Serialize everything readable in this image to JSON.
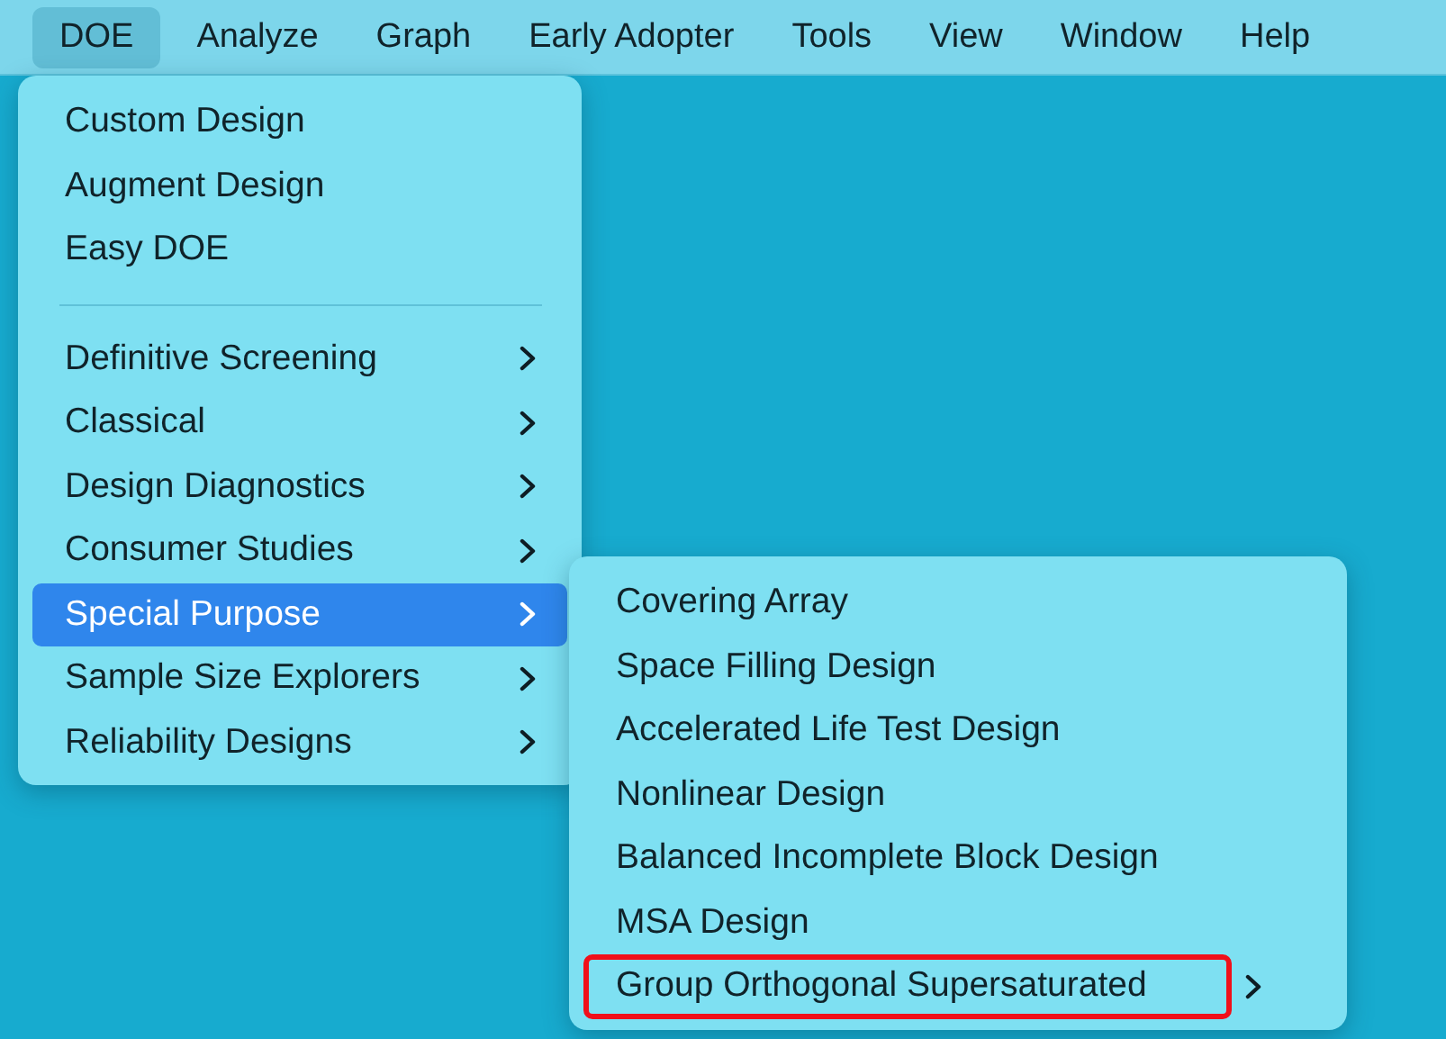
{
  "menu_bar": [
    {
      "label": "DOE",
      "selected": true
    },
    {
      "label": "Analyze",
      "selected": false
    },
    {
      "label": "Graph",
      "selected": false
    },
    {
      "label": "Early Adopter",
      "selected": false
    },
    {
      "label": "Tools",
      "selected": false
    },
    {
      "label": "View",
      "selected": false
    },
    {
      "label": "Window",
      "selected": false
    },
    {
      "label": "Help",
      "selected": false
    }
  ],
  "doe_menu": [
    {
      "kind": "item",
      "label": "Custom Design",
      "selected": false
    },
    {
      "kind": "item",
      "label": "Augment Design",
      "selected": false
    },
    {
      "kind": "item",
      "label": "Easy DOE",
      "selected": false
    },
    {
      "kind": "separator"
    },
    {
      "kind": "submenu",
      "label": "Definitive Screening",
      "selected": false
    },
    {
      "kind": "submenu",
      "label": "Classical",
      "selected": false
    },
    {
      "kind": "submenu",
      "label": "Design Diagnostics",
      "selected": false
    },
    {
      "kind": "submenu",
      "label": "Consumer Studies",
      "selected": false
    },
    {
      "kind": "submenu",
      "label": "Special Purpose",
      "selected": true
    },
    {
      "kind": "submenu",
      "label": "Sample Size Explorers",
      "selected": false
    },
    {
      "kind": "submenu",
      "label": "Reliability Designs",
      "selected": false
    }
  ],
  "special_purpose_menu": [
    {
      "kind": "item",
      "label": "Covering Array",
      "selected": false,
      "highlighted": false
    },
    {
      "kind": "item",
      "label": "Space Filling Design",
      "selected": false,
      "highlighted": false
    },
    {
      "kind": "item",
      "label": "Accelerated Life Test Design",
      "selected": false,
      "highlighted": false
    },
    {
      "kind": "item",
      "label": "Nonlinear Design",
      "selected": false,
      "highlighted": false
    },
    {
      "kind": "item",
      "label": "Balanced Incomplete Block Design",
      "selected": false,
      "highlighted": false
    },
    {
      "kind": "item",
      "label": "MSA Design",
      "selected": false,
      "highlighted": false
    },
    {
      "kind": "submenu",
      "label": "Group Orthogonal Supersaturated",
      "selected": false,
      "highlighted": true
    }
  ]
}
